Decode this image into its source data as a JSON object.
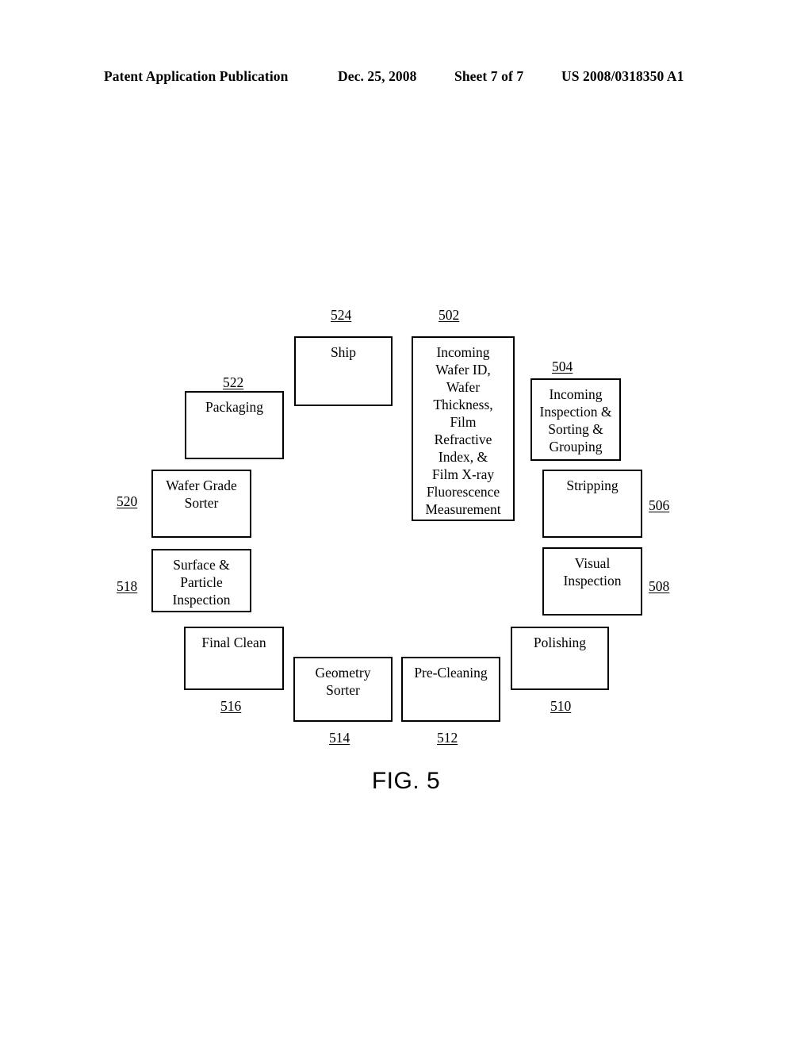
{
  "header": {
    "publication": "Patent Application Publication",
    "date": "Dec. 25, 2008",
    "sheet": "Sheet 7 of 7",
    "document_number": "US 2008/0318350 A1"
  },
  "figure": {
    "caption": "FIG. 5",
    "nodes": [
      {
        "id": "ship",
        "ref": "524",
        "label": "Ship"
      },
      {
        "id": "incoming-meas",
        "ref": "502",
        "label": "Incoming\nWafer ID,\nWafer\nThickness,\nFilm\nRefractive\nIndex, &\nFilm X-ray\nFluorescence\nMeasurement"
      },
      {
        "id": "incoming-insp",
        "ref": "504",
        "label": "Incoming\nInspection &\nSorting &\nGrouping"
      },
      {
        "id": "stripping",
        "ref": "506",
        "label": "Stripping"
      },
      {
        "id": "visual-insp",
        "ref": "508",
        "label": "Visual\nInspection"
      },
      {
        "id": "polishing",
        "ref": "510",
        "label": "Polishing"
      },
      {
        "id": "pre-cleaning",
        "ref": "512",
        "label": "Pre-Cleaning"
      },
      {
        "id": "geometry-sorter",
        "ref": "514",
        "label": "Geometry\nSorter"
      },
      {
        "id": "final-clean",
        "ref": "516",
        "label": "Final Clean"
      },
      {
        "id": "surface-part",
        "ref": "518",
        "label": "Surface &\nParticle\nInspection"
      },
      {
        "id": "wafer-grade",
        "ref": "520",
        "label": "Wafer Grade\nSorter"
      },
      {
        "id": "packaging",
        "ref": "522",
        "label": "Packaging"
      }
    ]
  }
}
